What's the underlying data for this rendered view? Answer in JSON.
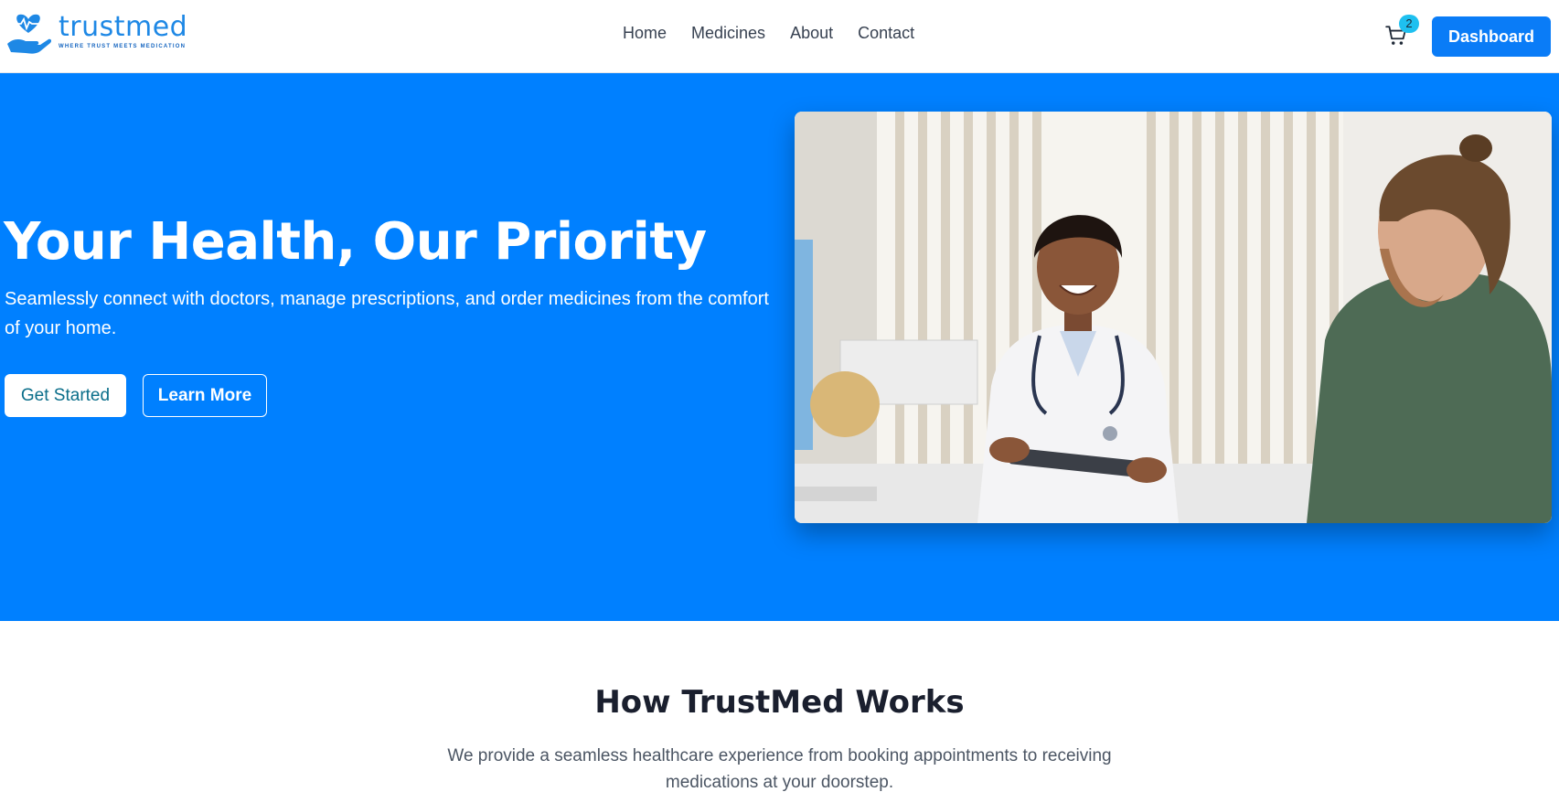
{
  "brand": {
    "name": "trustmed",
    "tagline": "WHERE TRUST MEETS MEDICATION",
    "color": "#1e88e5"
  },
  "nav": {
    "items": [
      {
        "label": "Home"
      },
      {
        "label": "Medicines"
      },
      {
        "label": "About"
      },
      {
        "label": "Contact"
      }
    ]
  },
  "cart": {
    "count": "2",
    "icon": "shopping-cart-icon"
  },
  "header": {
    "dashboard_label": "Dashboard"
  },
  "hero": {
    "title": "Your Health, Our Priority",
    "subtitle": "Seamlessly connect with doctors, manage prescriptions, and order medicines from the comfort of your home.",
    "primary_button": "Get Started",
    "secondary_button": "Learn More",
    "background": "#0080ff"
  },
  "how": {
    "title": "How TrustMed Works",
    "subtitle": "We provide a seamless healthcare experience from booking appointments to receiving medications at your doorstep."
  },
  "colors": {
    "accent": "#0a7cf7",
    "badge": "#1ec0f0"
  }
}
